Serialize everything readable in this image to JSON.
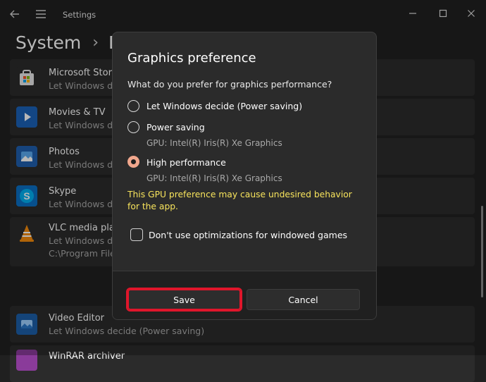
{
  "window": {
    "title": "Settings"
  },
  "header": {
    "title": "System",
    "sub": "D"
  },
  "apps": [
    {
      "name": "Microsoft Store",
      "sub": "Let Windows decide (Power saving)",
      "icon": "microsoft-store-icon"
    },
    {
      "name": "Movies & TV",
      "sub": "Let Windows decide (Power saving)",
      "icon": "movies-tv-icon"
    },
    {
      "name": "Photos",
      "sub": "Let Windows decide (Power saving)",
      "icon": "photos-icon"
    },
    {
      "name": "Skype",
      "sub": "Let Windows decide (Power saving)",
      "icon": "skype-icon"
    },
    {
      "name": "VLC media player",
      "sub": "Let Windows decide (Power saving)",
      "sub2": "C:\\Program Files",
      "icon": "vlc-icon"
    },
    {
      "name": "Video Editor",
      "sub": "Let Windows decide (Power saving)",
      "icon": "video-editor-icon"
    },
    {
      "name": "WinRAR archiver",
      "icon": "winrar-icon"
    }
  ],
  "dialog": {
    "title": "Graphics preference",
    "question": "What do you prefer for graphics performance?",
    "options": [
      {
        "label": "Let Windows decide (Power saving)",
        "checked": false
      },
      {
        "label": "Power saving",
        "gpu": "GPU: Intel(R) Iris(R) Xe Graphics",
        "checked": false
      },
      {
        "label": "High performance",
        "gpu": "GPU: Intel(R) Iris(R) Xe Graphics",
        "checked": true
      }
    ],
    "warning": "This GPU preference may cause undesired behavior for the app.",
    "checkbox_label": "Don't use optimizations for windowed games",
    "save_label": "Save",
    "cancel_label": "Cancel"
  },
  "colors": {
    "accent": "#f1a78d",
    "warning": "#f8e45c",
    "highlight": "#e0162b"
  }
}
